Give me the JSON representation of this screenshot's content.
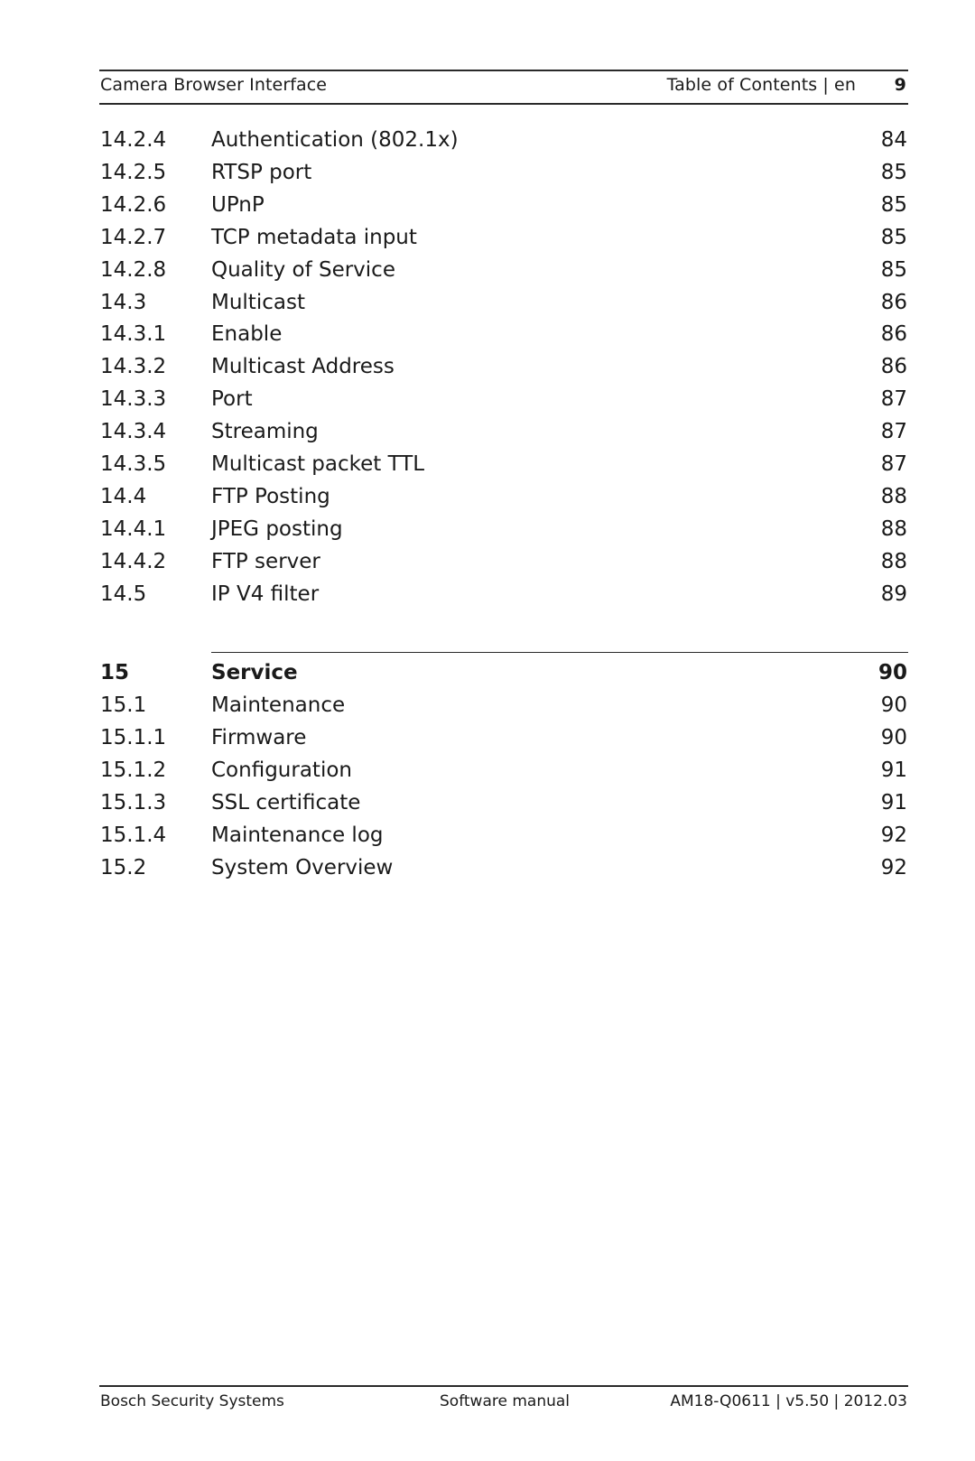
{
  "header": {
    "doc_title": "Camera Browser Interface",
    "section": "Table of Contents | en",
    "page_number": "9"
  },
  "toc": {
    "group1": [
      {
        "num": "14.2.4",
        "title": "Authentication (802.1x)",
        "page": "84"
      },
      {
        "num": "14.2.5",
        "title": "RTSP port",
        "page": "85"
      },
      {
        "num": "14.2.6",
        "title": "UPnP",
        "page": "85"
      },
      {
        "num": "14.2.7",
        "title": "TCP metadata input",
        "page": "85"
      },
      {
        "num": "14.2.8",
        "title": "Quality of Service",
        "page": "85"
      },
      {
        "num": "14.3",
        "title": "Multicast",
        "page": "86"
      },
      {
        "num": "14.3.1",
        "title": "Enable",
        "page": "86"
      },
      {
        "num": "14.3.2",
        "title": "Multicast Address",
        "page": "86"
      },
      {
        "num": "14.3.3",
        "title": "Port",
        "page": "87"
      },
      {
        "num": "14.3.4",
        "title": "Streaming",
        "page": "87"
      },
      {
        "num": "14.3.5",
        "title": "Multicast packet TTL",
        "page": "87"
      },
      {
        "num": "14.4",
        "title": "FTP Posting",
        "page": "88"
      },
      {
        "num": "14.4.1",
        "title": "JPEG posting",
        "page": "88"
      },
      {
        "num": "14.4.2",
        "title": "FTP server",
        "page": "88"
      },
      {
        "num": "14.5",
        "title": "IP V4 filter",
        "page": "89"
      }
    ],
    "chapter": {
      "num": "15",
      "title": "Service",
      "page": "90"
    },
    "group2": [
      {
        "num": "15.1",
        "title": "Maintenance",
        "page": "90"
      },
      {
        "num": "15.1.1",
        "title": "Firmware",
        "page": "90"
      },
      {
        "num": "15.1.2",
        "title": "Configuration",
        "page": "91"
      },
      {
        "num": "15.1.3",
        "title": "SSL certificate",
        "page": "91"
      },
      {
        "num": "15.1.4",
        "title": "Maintenance log",
        "page": "92"
      },
      {
        "num": "15.2",
        "title": "System Overview",
        "page": "92"
      }
    ]
  },
  "footer": {
    "company": "Bosch Security Systems",
    "doc_type": "Software manual",
    "doc_id": "AM18-Q0611 | v5.50 | 2012.03"
  }
}
